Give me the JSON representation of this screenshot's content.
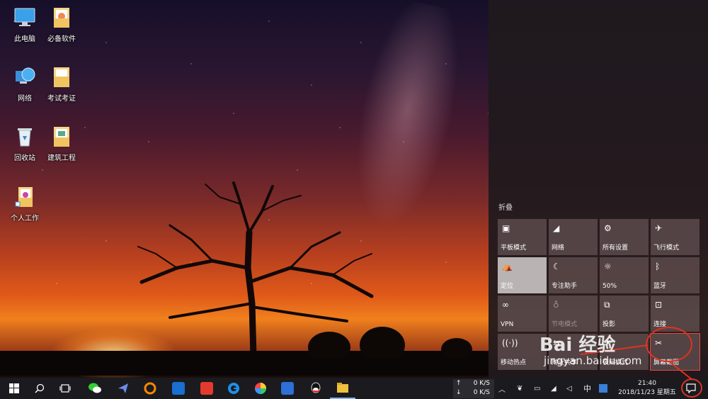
{
  "desktop": {
    "icons": [
      {
        "label": "此电脑",
        "icon": "computer-icon"
      },
      {
        "label": "必备软件",
        "icon": "folder-icon"
      },
      {
        "label": "网络",
        "icon": "network-globe-icon"
      },
      {
        "label": "考试考证",
        "icon": "folder-icon"
      },
      {
        "label": "回收站",
        "icon": "recycle-bin-icon"
      },
      {
        "label": "建筑工程",
        "icon": "folder-icon"
      },
      {
        "label": "个人工作",
        "icon": "folder-icon"
      }
    ]
  },
  "action_center": {
    "collapse_label": "折叠",
    "tiles": [
      {
        "label": "平板模式",
        "icon": "tablet-mode-icon",
        "state": "normal"
      },
      {
        "label": "网络",
        "icon": "network-icon",
        "state": "normal"
      },
      {
        "label": "所有设置",
        "icon": "gear-icon",
        "state": "normal"
      },
      {
        "label": "飞行模式",
        "icon": "airplane-icon",
        "state": "normal"
      },
      {
        "label": "定位",
        "icon": "location-icon",
        "state": "on"
      },
      {
        "label": "专注助手",
        "icon": "moon-icon",
        "state": "normal"
      },
      {
        "label": "50%",
        "icon": "brightness-icon",
        "state": "normal"
      },
      {
        "label": "蓝牙",
        "icon": "bluetooth-icon",
        "state": "normal"
      },
      {
        "label": "VPN",
        "icon": "vpn-icon",
        "state": "normal"
      },
      {
        "label": "节电模式",
        "icon": "battery-saver-icon",
        "state": "off"
      },
      {
        "label": "投影",
        "icon": "project-icon",
        "state": "normal"
      },
      {
        "label": "连接",
        "icon": "connect-icon",
        "state": "normal"
      },
      {
        "label": "移动热点",
        "icon": "hotspot-icon",
        "state": "normal"
      },
      {
        "label": "附近共享",
        "icon": "nearby-share-icon",
        "state": "normal"
      },
      {
        "label": "夜间模式",
        "icon": "night-light-icon",
        "state": "normal"
      },
      {
        "label": "屏幕截图",
        "icon": "screen-snip-icon",
        "state": "normal"
      }
    ]
  },
  "taskbar": {
    "net_up": "0 K/S",
    "net_down": "0 K/S",
    "ime": "中",
    "time": "21:40",
    "date": "2018/11/23 星期五"
  },
  "watermark": {
    "brand": "Bai 经验",
    "url": "jingyan.baidu.com"
  },
  "colors": {
    "action_center_bg": "#201a1e",
    "tile_bg": "#786464",
    "tile_on": "#b9b3b3",
    "annotation_red": "#dd3322",
    "taskbar_bg": "#1b1b1f"
  }
}
